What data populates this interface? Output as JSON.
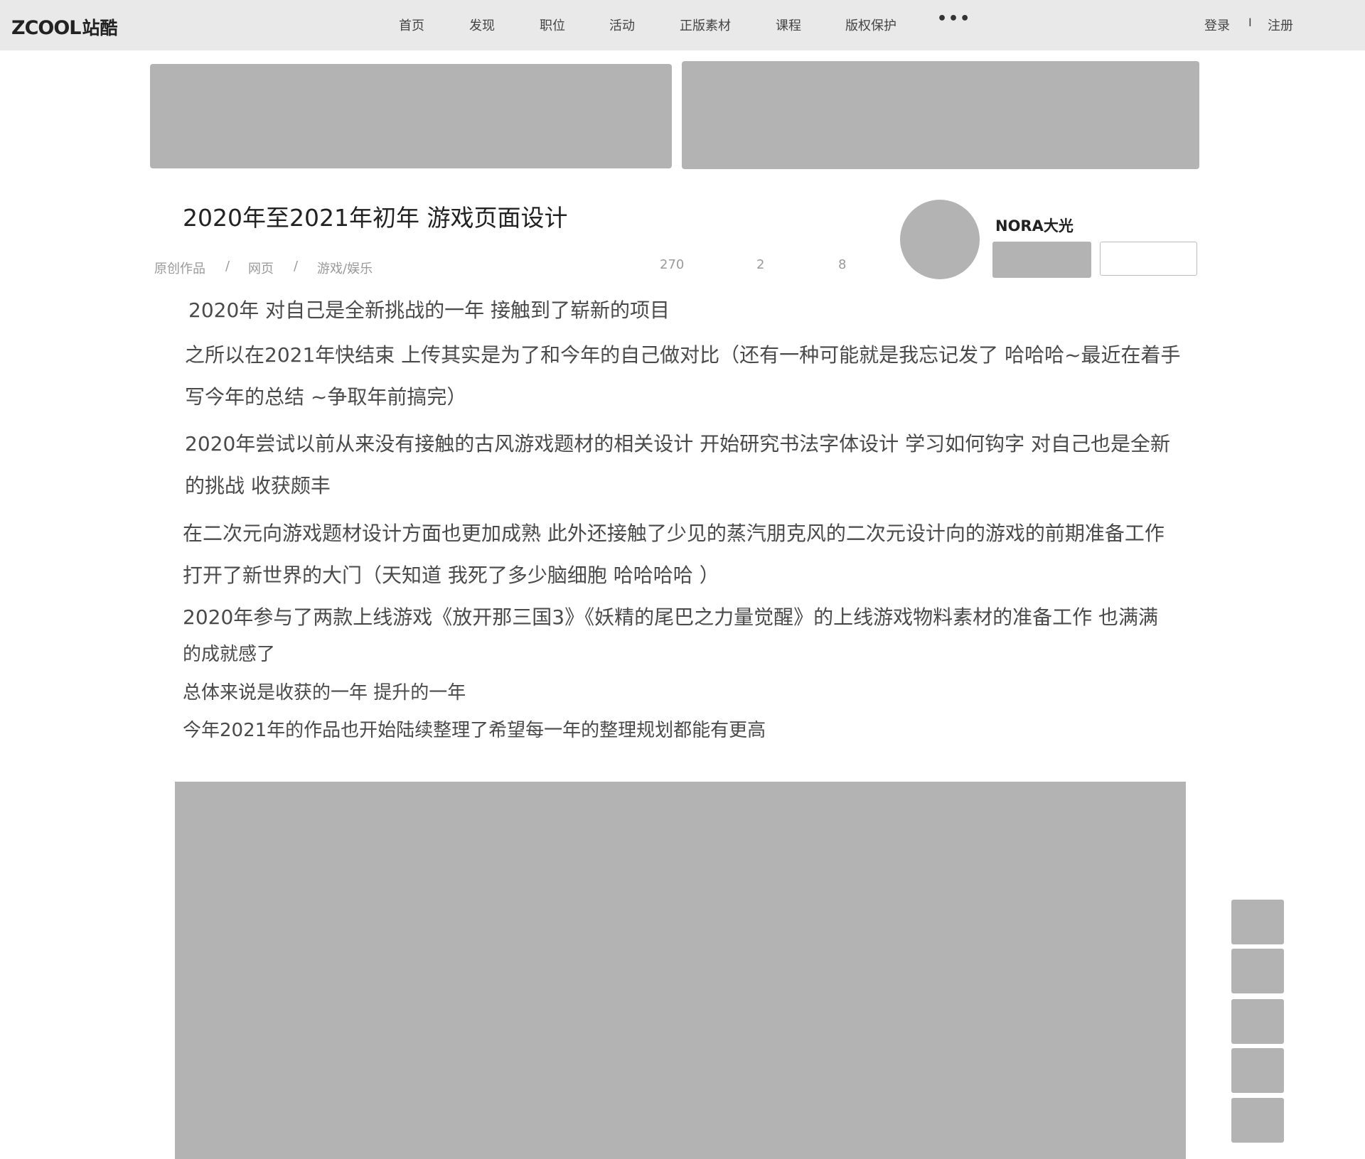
{
  "header": {
    "logo_latin": "ZCOOL",
    "logo_cjk": "站酷",
    "nav": [
      {
        "label": "首页"
      },
      {
        "label": "发现"
      },
      {
        "label": "职位"
      },
      {
        "label": "活动"
      },
      {
        "label": "正版素材"
      },
      {
        "label": "课程"
      },
      {
        "label": "版权保护"
      }
    ],
    "more": "•••",
    "login": "登录",
    "separator": "I",
    "register": "注册"
  },
  "work": {
    "title": "2020年至2021年初年 游戏页面设计",
    "breadcrumb": [
      "原创作品",
      "网页",
      "游戏/娱乐"
    ],
    "breadcrumb_sep": "/",
    "stats": [
      "270",
      "2",
      "8"
    ]
  },
  "author": {
    "name": "NORA大光"
  },
  "content": {
    "lines": [
      "2020年 对自己是全新挑战的一年 接触到了崭新的项目",
      "之所以在2021年快结束 上传其实是为了和今年的自己做对比（还有一种可能就是我忘记发了 哈哈哈~最近在着手",
      "写今年的总结 ~争取年前搞完）",
      "2020年尝试以前从来没有接触的古风游戏题材的相关设计 开始研究书法字体设计 学习如何钩字 对自己也是全新",
      "的挑战 收获颇丰",
      "在二次元向游戏题材设计方面也更加成熟 此外还接触了少见的蒸汽朋克风的二次元设计向的游戏的前期准备工作",
      "打开了新世界的大门（天知道 我死了多少脑细胞 哈哈哈哈 ）",
      "2020年参与了两款上线游戏《放开那三国3》《妖精的尾巴之力量觉醒》的上线游戏物料素材的准备工作 也满满",
      "的成就感了",
      "总体来说是收获的一年 提升的一年",
      "今年2021年的作品也开始陆续整理了希望每一年的整理规划都能有更高"
    ]
  }
}
